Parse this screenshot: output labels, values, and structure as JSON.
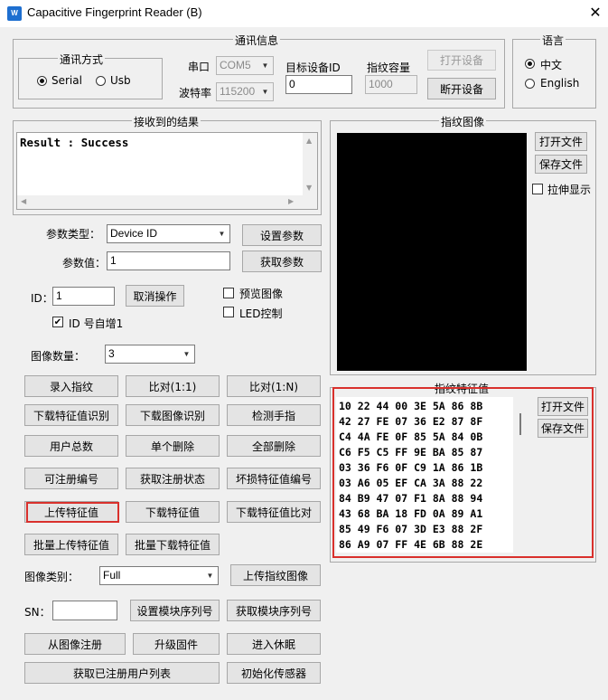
{
  "window": {
    "title": "Capacitive Fingerprint Reader (B)",
    "icon_text": "W",
    "close": "✕"
  },
  "comm": {
    "group_label": "通讯信息",
    "mode_label": "通讯方式",
    "serial": "Serial",
    "usb": "Usb",
    "port_label": "串口",
    "port_value": "COM5",
    "baud_label": "波特率",
    "baud_value": "115200",
    "target_id_label": "目标设备ID",
    "target_id_value": "0",
    "capacity_label": "指纹容量",
    "capacity_value": "1000",
    "open_device": "打开设备",
    "close_device": "断开设备"
  },
  "language": {
    "label": "语言",
    "chinese": "中文",
    "english": "English"
  },
  "result": {
    "label": "接收到的结果",
    "text": "Result : Success"
  },
  "image_panel": {
    "label": "指纹图像",
    "open_file": "打开文件",
    "save_file": "保存文件",
    "stretch": "拉伸显示"
  },
  "params": {
    "type_label": "参数类型：",
    "type_value": "Device ID",
    "set_button": "设置参数",
    "value_label": "参数值：",
    "value": "1",
    "get_button": "获取参数"
  },
  "id": {
    "label": "ID：",
    "value": "1",
    "cancel_button": "取消操作",
    "preview": "预览图像",
    "led": "LED控制",
    "auto_inc": "ID 号自增1"
  },
  "image_count": {
    "label": "图像数量：",
    "value": "3"
  },
  "buttons": {
    "enroll": "录入指纹",
    "match_1_1": "比对(1:1)",
    "match_1_n": "比对(1:N)",
    "download_feature_identify": "下载特征值识别",
    "download_image_identify": "下载图像识别",
    "detect_finger": "检测手指",
    "user_total": "用户总数",
    "delete_single": "单个删除",
    "delete_all": "全部删除",
    "enrollable_number": "可注册编号",
    "get_enroll_status": "获取注册状态",
    "bad_feature_number": "坏损特征值编号",
    "upload_feature": "上传特征值",
    "download_feature": "下载特征值",
    "download_feature_compare": "下载特征值比对",
    "batch_upload": "批量上传特征值",
    "batch_download": "批量下载特征值",
    "upload_fp_image": "上传指纹图像",
    "set_sn": "设置模块序列号",
    "get_sn": "获取模块序列号",
    "register_from_image": "从图像注册",
    "upgrade_firmware": "升级固件",
    "enter_sleep": "进入休眠",
    "get_user_list": "获取已注册用户列表",
    "init_sensor": "初始化传感器"
  },
  "image_type": {
    "label": "图像类别：",
    "value": "Full"
  },
  "sn": {
    "label": "SN：",
    "value": ""
  },
  "feature": {
    "label": "指纹特征值",
    "open_file": "打开文件",
    "save_file": "保存文件",
    "hex_rows": [
      "10 22 44 00 3E 5A 86 8B",
      "42 27 FE 07 36 E2 87 8F",
      "C4 4A FE 0F 85 5A 84 0B",
      "C6 F5 C5 FF 9E BA 85 87",
      "03 36 F6 0F C9 1A 86 1B",
      "03 A6 05 EF CA 3A 88 22",
      "84 B9 47 07 F1 8A 88 94",
      "43 68 BA 18 FD 0A 89 A1",
      "85 49 F6 07 3D E3 88 2F",
      "86 A9 07 FF 4E 6B 88 2E"
    ]
  },
  "colors": {
    "highlight": "#d9302c",
    "image_bg": "#000000",
    "accent": "#1e6fd0"
  }
}
